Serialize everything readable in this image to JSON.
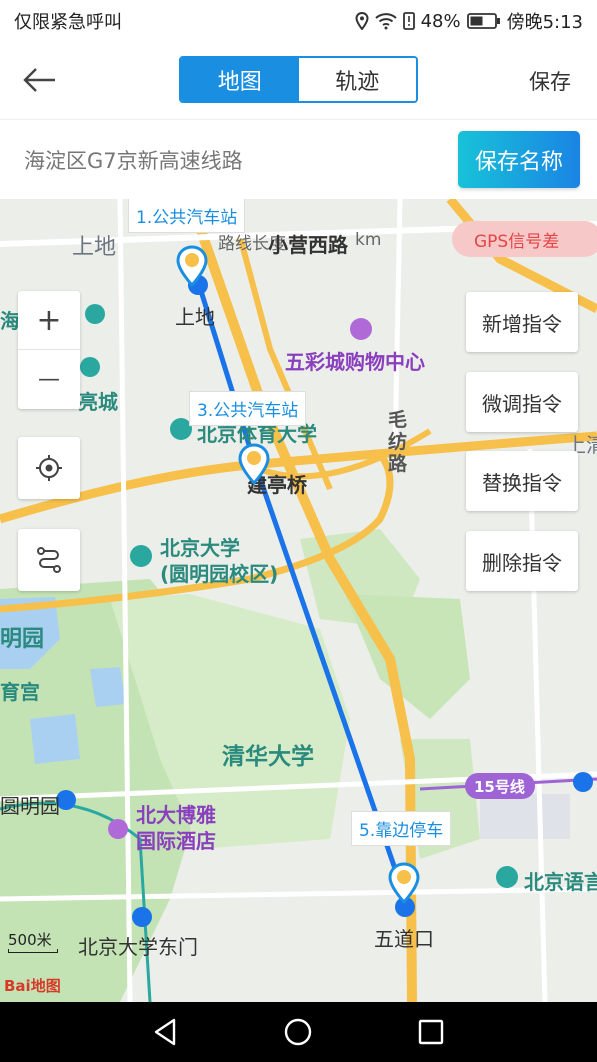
{
  "status": {
    "left_text": "仅限紧急呼叫",
    "battery": "48%",
    "time": "傍晚5:13"
  },
  "header": {
    "tabs": [
      "地图",
      "轨迹"
    ],
    "active_tab": "地图",
    "save": "保存"
  },
  "route_name": {
    "value": "海淀区G7京新高速线路",
    "save_button": "保存名称"
  },
  "map": {
    "gps_status": "GPS信号差",
    "callouts": [
      "1.公共汽车站",
      "3.公共汽车站",
      "5.靠边停车"
    ],
    "commands": [
      "新增指令",
      "微调指令",
      "替换指令",
      "删除指令"
    ],
    "zoom_in": "+",
    "zoom_out": "—",
    "scale": "500米",
    "logo": "Bai地图",
    "labels": {
      "shangdi_area": "上地",
      "shangdi_station": "上地",
      "road_info": "路线长度",
      "road_unit": "km",
      "xiaoying": "小营西路",
      "wucai": "五彩城购物中心",
      "hai": "海",
      "xiliang": "亮城",
      "tiyu": "北京体育大学",
      "maofang": "毛纺路",
      "shangqing": "上清",
      "jianting": "建亭桥",
      "pku_campus": "北京大学\n(圆明园校区)",
      "mingyuan": "明园",
      "yuyu": "育宫",
      "tsinghua": "清华大学",
      "line15": "15号线",
      "yuanmingyuan": "圆明园",
      "boya": "北大博雅\n国际酒店",
      "blcu": "北京语言",
      "pku_east": "北京大学东门",
      "wudaokou": "五道口"
    }
  },
  "colors": {
    "accent": "#1a8ee1",
    "route": "#1a73e8",
    "highway": "#f6c04a",
    "gps_bg": "#f6c8c8",
    "gps_text": "#e64545"
  },
  "icons": [
    "back-arrow-icon",
    "location-icon",
    "wifi-icon",
    "sim-alert-icon",
    "battery-icon",
    "locate-icon",
    "route-toggle-icon",
    "pin-icon",
    "back-triangle-icon",
    "home-circle-icon",
    "recent-square-icon"
  ]
}
